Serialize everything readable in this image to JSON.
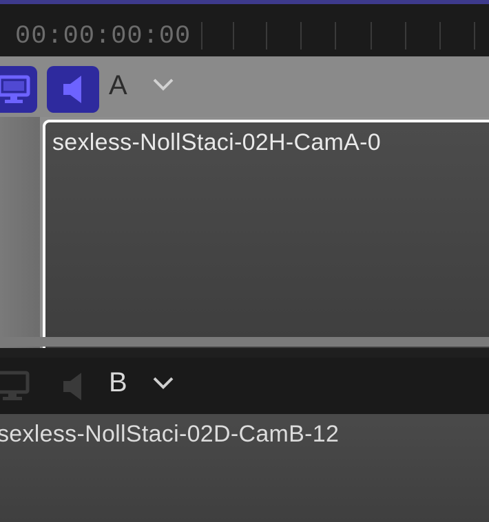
{
  "timeline": {
    "timecode": "00:00:00:00"
  },
  "angles": [
    {
      "letter": "A",
      "clip_name": "sexless-NollStaci-02H-CamA-0",
      "video_active": true,
      "audio_active": true
    },
    {
      "letter": "B",
      "clip_name": "sexless-NollStaci-02D-CamB-12",
      "video_active": false,
      "audio_active": false
    }
  ],
  "colors": {
    "active_button": "#2e2a9e",
    "active_icon": "#6d63ff",
    "selection_border": "#ffffff",
    "top_accent": "#3d3a8c"
  },
  "icons": {
    "video": "monitor-icon",
    "audio": "speaker-icon",
    "dropdown": "chevron-down-icon"
  }
}
